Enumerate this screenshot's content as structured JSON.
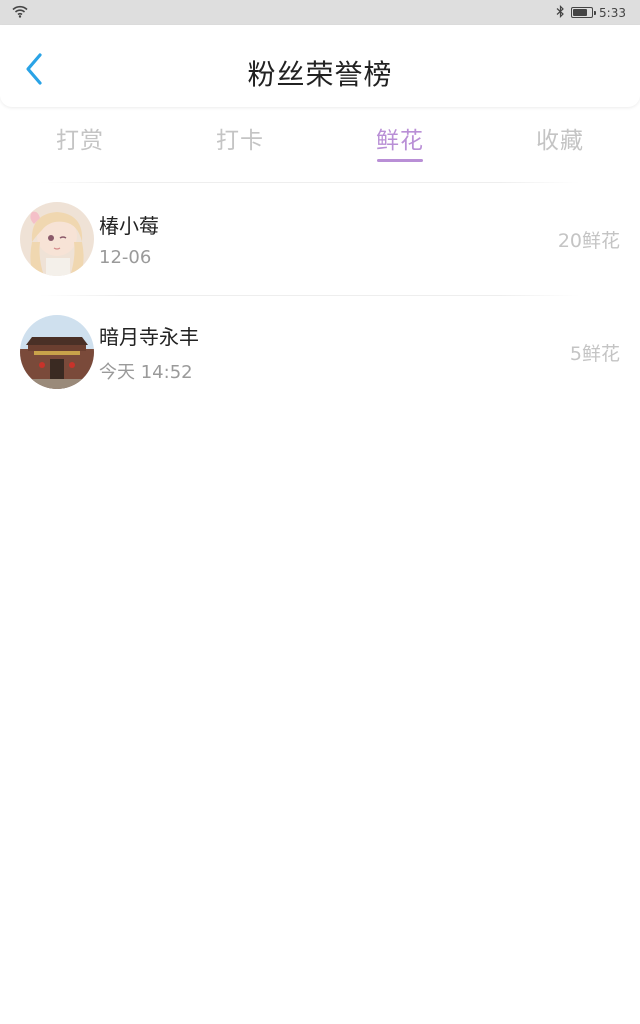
{
  "status_bar": {
    "time": "5:33",
    "battery_level": 0.8,
    "icons": [
      "wifi-icon",
      "bluetooth-icon",
      "battery-icon"
    ]
  },
  "header": {
    "back_icon": "chevron-left-icon",
    "title": "粉丝荣誉榜"
  },
  "tabs": [
    {
      "label": "打赏",
      "active": false
    },
    {
      "label": "打卡",
      "active": false
    },
    {
      "label": "鲜花",
      "active": true
    },
    {
      "label": "收藏",
      "active": false
    }
  ],
  "list": [
    {
      "name": "椿小莓",
      "time": "12-06",
      "count": "20鲜花",
      "avatar": "anime-girl-avatar"
    },
    {
      "name": "暗月寺永丰",
      "time": "今天 14:52",
      "count": "5鲜花",
      "avatar": "temple-photo-avatar"
    }
  ],
  "colors": {
    "accent": "#b98fd6",
    "back_arrow": "#2aa3e6",
    "inactive_tab": "#c4c4c4",
    "status_bar_bg": "#dedede"
  }
}
